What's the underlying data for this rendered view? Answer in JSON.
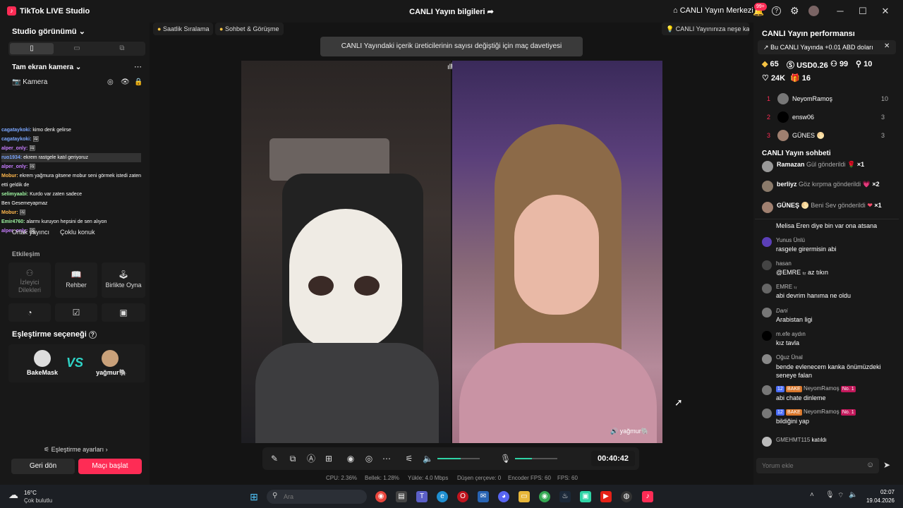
{
  "titlebar": {
    "app_title": "TikTok LIVE Studio",
    "center_title": "CANLI Yayın bilgileri",
    "live_center": "CANLI Yayın Merkezi",
    "notif_badge": "99+"
  },
  "left": {
    "studio_view": "Studio görünümü",
    "camera_section": "Tam ekran kamera",
    "camera_item": "Kamera",
    "chat_overlay": [
      {
        "user": "cagataykoki:",
        "msg": "kimo denk gelirse"
      },
      {
        "user": "cagataykoki:",
        "msg": "🖼"
      },
      {
        "user": "alper_only:",
        "msg": "🖼"
      },
      {
        "user": "ruo1934:",
        "msg": "ekrem rastgele katıl geriyoruz"
      },
      {
        "user": "alper_only:",
        "msg": "🖼"
      },
      {
        "user": "Mobur:",
        "msg": "ekrem yağmura gitsene mobur seni görmek istedi zaten"
      },
      {
        "user": "",
        "msg": "etti geldik de"
      },
      {
        "user": "selimyaabi:",
        "msg": "Kurdo var zaten sadece"
      },
      {
        "user": "",
        "msg": "Ben Gesemeyapmaz"
      },
      {
        "user": "Mobur:",
        "msg": "🖼"
      },
      {
        "user": "Emir4760:",
        "msg": "alarmı kuruyon hepsini de sen alıyon"
      },
      {
        "user": "alper_only:",
        "msg": "🖼"
      }
    ],
    "cohost_tabs": [
      "Ortak yayıncı",
      "Çoklu konuk"
    ],
    "interaction_title": "Etkileşim",
    "interaction_tiles": [
      "İzleyici Dilekleri",
      "Rehber",
      "Birlikte Oyna"
    ],
    "match_title": "Eşleştirme seçeneği",
    "match_left": "BakeMask",
    "match_vs": "VS",
    "match_right": "yağmur🐘",
    "match_settings": "Eşleştirme ayarları",
    "back_button": "Geri dön",
    "start_button": "Maçı başlat"
  },
  "center": {
    "chip_hourly": "Saatlik Sıralama",
    "chip_chat": "Sohbet & Görüşme",
    "chip_join": "CANLI Yayınınıza neşe katın",
    "toast": "CANLI Yayındaki içerik üreticilerinin sayısı değiştiği için maç davetiyesi gönderilemedi",
    "right_streamer": "yağmur🐘",
    "timer": "00:40:42",
    "stats": {
      "cpu": "CPU: 2.36%",
      "memory": "Bellek: 1.28%",
      "upload": "Yükle: 4.0 Mbps",
      "dropped": "Düşen çerçeve: 0",
      "encoder_fps": "Encoder FPS: 60",
      "fps": "FPS: 60"
    },
    "mic_level": 0.4,
    "audio_level": 0.55
  },
  "right": {
    "perf_title": "CANLI Yayın performansı",
    "perf_banner": "Bu CANLI Yayında +0.01 ABD doları",
    "metrics": {
      "diamonds": "65",
      "usd": "USD0.26",
      "viewers": "99",
      "followers": "10",
      "likes": "24K",
      "gifters": "16"
    },
    "ranking": [
      {
        "rank": "1",
        "name": "NeyomRamoş",
        "score": "10"
      },
      {
        "rank": "2",
        "name": "ensw06",
        "score": "3"
      },
      {
        "rank": "3",
        "name": "GÜNES 🌕",
        "score": "3"
      }
    ],
    "chat_title": "CANLI Yayın sohbeti",
    "gifts": [
      {
        "name": "Ramazan",
        "action": "Gül gönderildi",
        "count": "×1"
      },
      {
        "name": "berliyz",
        "action": "Göz kırpma gönderildi",
        "count": "×2"
      },
      {
        "name": "GÜNEŞ 🌕",
        "action": "Beni Sev gönderildi",
        "count": "×1"
      }
    ],
    "chat_cut": "Melisa Eren diye bin var ona atsana",
    "chat": [
      {
        "user": "Yunus Ünlü",
        "msg": "rasgele girermisin abi"
      },
      {
        "user": "hasan",
        "msg": "@EMRE ₜᵣ az tıkın"
      },
      {
        "user": "EMRE ₜᵣ",
        "msg": "abi devrim hanıma ne oldu"
      },
      {
        "user": "Dani",
        "msg": "Arabistan ligi"
      },
      {
        "user": "m.efe aydın",
        "msg": "kız tavla"
      },
      {
        "user": "Oğuz Ünal",
        "msg": "bende evlenecem kanka önümüzdeki seneye falan"
      },
      {
        "user": "NeyomRamoş",
        "msg": "abi chate dinleme"
      },
      {
        "user": "NeyomRamoş",
        "msg": "bildiğini yap"
      }
    ],
    "badge_level": "12",
    "badge_bake": "BAKE",
    "badge_no1": "No. 1",
    "join_user": "GMEHMT115",
    "join_text": "katıldı",
    "comment_placeholder": "Yorum ekle"
  },
  "taskbar": {
    "weather_temp": "16°C",
    "weather_desc": "Çok bulutlu",
    "search_placeholder": "Ara",
    "time": "02:07",
    "date": "19.04.2026"
  }
}
